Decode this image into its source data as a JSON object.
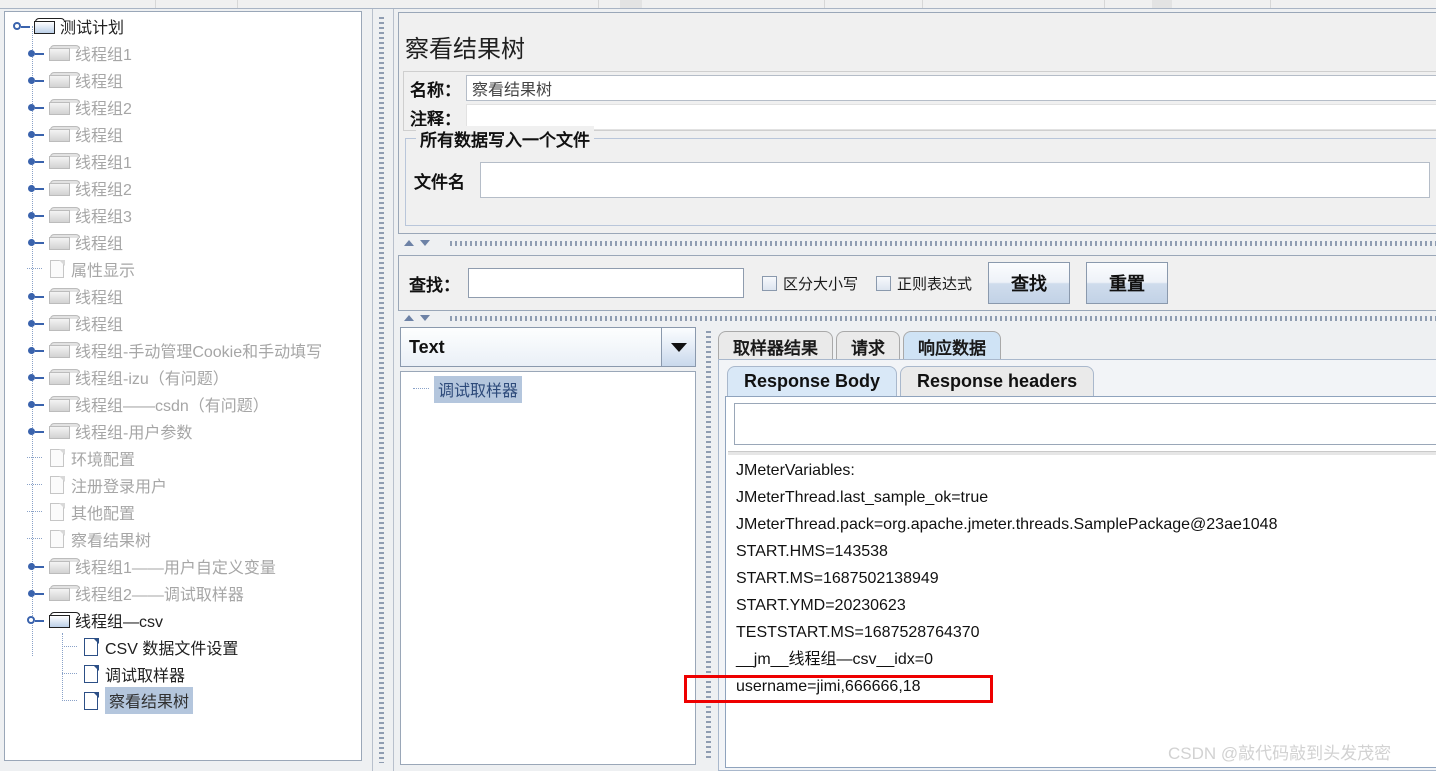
{
  "tree": {
    "root": {
      "label": "测试计划",
      "icon": "folder-icon",
      "state": "active"
    },
    "items": [
      {
        "label": "线程组1",
        "icon": "folder-icon",
        "expandable": true,
        "dim": true
      },
      {
        "label": "线程组",
        "icon": "folder-icon",
        "expandable": true,
        "dim": true
      },
      {
        "label": "线程组2",
        "icon": "folder-icon",
        "expandable": true,
        "dim": true
      },
      {
        "label": "线程组",
        "icon": "folder-icon",
        "expandable": true,
        "dim": true
      },
      {
        "label": "线程组1",
        "icon": "folder-icon",
        "expandable": true,
        "dim": true
      },
      {
        "label": "线程组2",
        "icon": "folder-icon",
        "expandable": true,
        "dim": true
      },
      {
        "label": "线程组3",
        "icon": "folder-icon",
        "expandable": true,
        "dim": true
      },
      {
        "label": "线程组",
        "icon": "folder-icon",
        "expandable": true,
        "dim": true
      },
      {
        "label": "属性显示",
        "icon": "page-icon",
        "expandable": false,
        "dim": true
      },
      {
        "label": "线程组",
        "icon": "folder-icon",
        "expandable": true,
        "dim": true
      },
      {
        "label": "线程组",
        "icon": "folder-icon",
        "expandable": true,
        "dim": true
      },
      {
        "label": "线程组-手动管理Cookie和手动填写",
        "icon": "folder-icon",
        "expandable": true,
        "dim": true
      },
      {
        "label": "线程组-izu（有问题）",
        "icon": "folder-icon",
        "expandable": true,
        "dim": true
      },
      {
        "label": "线程组——csdn（有问题）",
        "icon": "folder-icon",
        "expandable": true,
        "dim": true
      },
      {
        "label": "线程组-用户参数",
        "icon": "folder-icon",
        "expandable": true,
        "dim": true
      },
      {
        "label": "环境配置",
        "icon": "page-icon",
        "expandable": false,
        "dim": true
      },
      {
        "label": "注册登录用户",
        "icon": "page-icon",
        "expandable": false,
        "dim": true
      },
      {
        "label": "其他配置",
        "icon": "page-icon",
        "expandable": false,
        "dim": true
      },
      {
        "label": "察看结果树",
        "icon": "page-icon",
        "expandable": false,
        "dim": true
      },
      {
        "label": "线程组1——用户自定义变量",
        "icon": "folder-icon",
        "expandable": true,
        "dim": true
      },
      {
        "label": "线程组2——调试取样器",
        "icon": "folder-icon",
        "expandable": true,
        "dim": true
      },
      {
        "label": "线程组—csv",
        "icon": "folder-icon",
        "expandable": true,
        "dim": false,
        "open": true
      }
    ],
    "children": [
      {
        "label": "CSV 数据文件设置",
        "icon": "page-icon",
        "dim": false,
        "selected": false
      },
      {
        "label": "调试取样器",
        "icon": "page-icon",
        "dim": false,
        "selected": false
      },
      {
        "label": "察看结果树",
        "icon": "page-icon",
        "dim": false,
        "selected": true
      }
    ]
  },
  "config": {
    "title": "察看结果树",
    "name_label": "名称：",
    "name_value": "察看结果树",
    "comment_label": "注释：",
    "comment_value": "",
    "group_legend": "所有数据写入一个文件",
    "filename_label": "文件名",
    "filename_value": ""
  },
  "search": {
    "label": "查找：",
    "value": "",
    "case_sensitive_label": "区分大小写",
    "case_sensitive_checked": false,
    "regex_label": "正则表达式",
    "regex_checked": false,
    "find_button": "查找",
    "reset_button": "重置"
  },
  "results": {
    "renderer_combo": "Text",
    "tree_item": "调试取样器",
    "outer_tabs": [
      {
        "label": "取样器结果",
        "active": false
      },
      {
        "label": "请求",
        "active": false
      },
      {
        "label": "响应数据",
        "active": true
      }
    ],
    "inner_tabs": [
      {
        "label": "Response Body",
        "active": true
      },
      {
        "label": "Response headers",
        "active": false
      }
    ],
    "body_search_value": "",
    "body_lines": [
      "JMeterVariables:",
      "JMeterThread.last_sample_ok=true",
      "JMeterThread.pack=org.apache.jmeter.threads.SamplePackage@23ae1048",
      "START.HMS=143538",
      "START.MS=1687502138949",
      "START.YMD=20230623",
      "TESTSTART.MS=1687528764370",
      "__jm__线程组—csv__idx=0",
      "username=jimi,666666,18"
    ]
  },
  "annotation": {
    "highlight_color": "#ee0000",
    "highlighted_line": "username=jimi,666666,18"
  },
  "watermark": "CSDN @敲代码敲到头发茂密"
}
